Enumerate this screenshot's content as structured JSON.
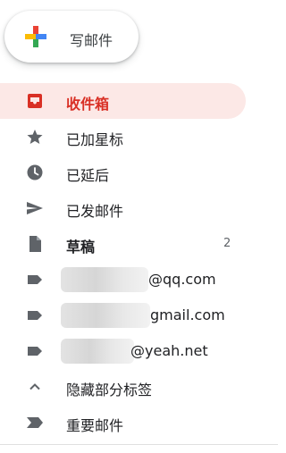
{
  "compose": {
    "label": "写邮件"
  },
  "nav": {
    "items": [
      {
        "label": "收件箱",
        "icon": "inbox-icon",
        "active": true
      },
      {
        "label": "已加星标",
        "icon": "star-icon"
      },
      {
        "label": "已延后",
        "icon": "clock-icon"
      },
      {
        "label": "已发邮件",
        "icon": "send-icon"
      },
      {
        "label": "草稿",
        "icon": "draft-icon",
        "count": "2"
      },
      {
        "label": "@qq.com",
        "icon": "label-icon"
      },
      {
        "label": "gmail.com",
        "icon": "label-icon"
      },
      {
        "label": "@yeah.net",
        "icon": "label-icon"
      },
      {
        "label": "隐藏部分标签",
        "icon": "chevron-up-icon"
      },
      {
        "label": "重要邮件",
        "icon": "important-icon"
      }
    ]
  },
  "colors": {
    "active_bg": "#fce8e6",
    "active_text": "#d93025",
    "icon_gray": "#5f6368",
    "plus_blue": "#4285f4",
    "plus_red": "#ea4335",
    "plus_yellow": "#fbbc04",
    "plus_green": "#34a853"
  }
}
